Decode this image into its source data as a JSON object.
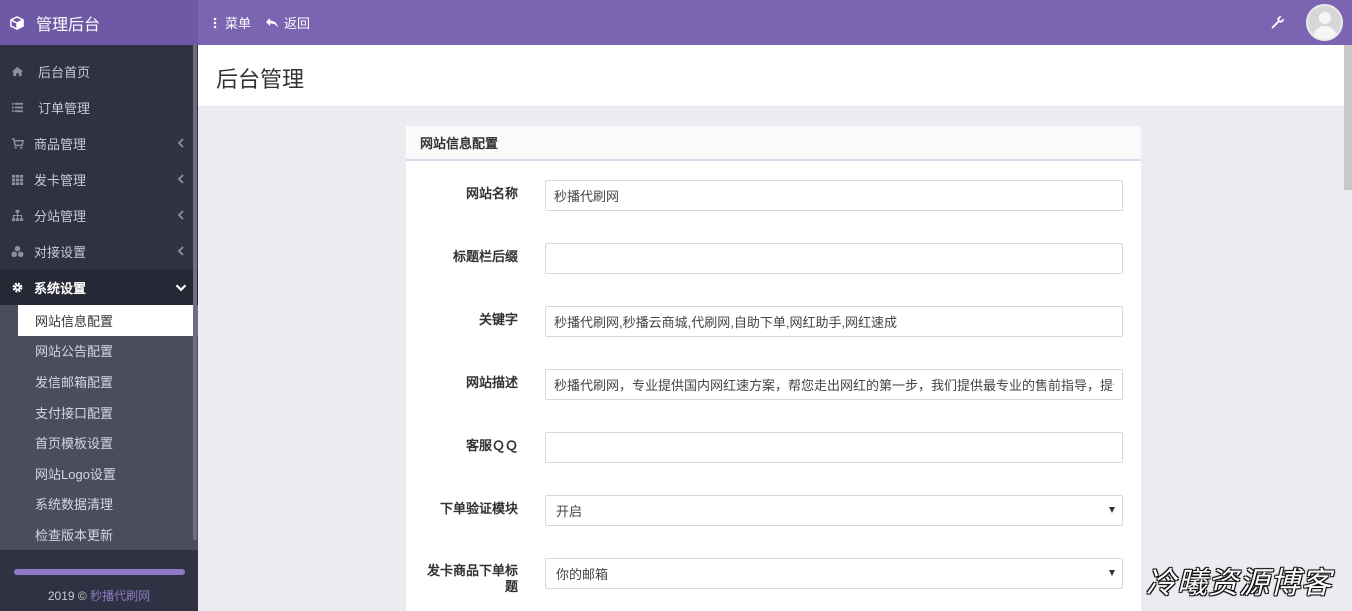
{
  "topbar": {
    "brand": "管理后台",
    "menu_label": "菜单",
    "back_label": "返回",
    "accent": "#7b64b2"
  },
  "sidebar": {
    "items": [
      {
        "label": "后台首页",
        "icon": "home-icon"
      },
      {
        "label": "订单管理",
        "icon": "list-icon"
      },
      {
        "label": "商品管理",
        "icon": "cart-icon",
        "expandable": true
      },
      {
        "label": "发卡管理",
        "icon": "grid-icon",
        "expandable": true
      },
      {
        "label": "分站管理",
        "icon": "sitemap-icon",
        "expandable": true
      },
      {
        "label": "对接设置",
        "icon": "cubes-icon",
        "expandable": true
      },
      {
        "label": "系统设置",
        "icon": "gear-icon",
        "expanded": true
      }
    ],
    "submenu": [
      {
        "label": "网站信息配置",
        "current": true
      },
      {
        "label": "网站公告配置"
      },
      {
        "label": "发信邮箱配置"
      },
      {
        "label": "支付接口配置"
      },
      {
        "label": "首页模板设置"
      },
      {
        "label": "网站Logo设置"
      },
      {
        "label": "系统数据清理"
      },
      {
        "label": "检查版本更新"
      }
    ],
    "copyright_year": "2019 ©",
    "copyright_site": "秒播代刷网"
  },
  "page": {
    "title": "后台管理"
  },
  "panel": {
    "title": "网站信息配置",
    "fields": {
      "site_name": {
        "label": "网站名称",
        "value": "秒播代刷网"
      },
      "title_suffix": {
        "label": "标题栏后缀",
        "value": ""
      },
      "keywords": {
        "label": "关键字",
        "value": "秒播代刷网,秒播云商城,代刷网,自助下单,网红助手,网红速成"
      },
      "description": {
        "label": "网站描述",
        "value": "秒播代刷网，专业提供国内网红速方案，帮您走出网红的第一步，我们提供最专业的售前指导，提供"
      },
      "service_qq": {
        "label": "客服ＱＱ",
        "value": ""
      },
      "order_verify": {
        "label": "下单验证模块",
        "selected": "开启"
      },
      "card_order_title": {
        "label": "发卡商品下单标题",
        "selected": "你的邮箱"
      }
    }
  },
  "watermark": "冷曦资源博客"
}
